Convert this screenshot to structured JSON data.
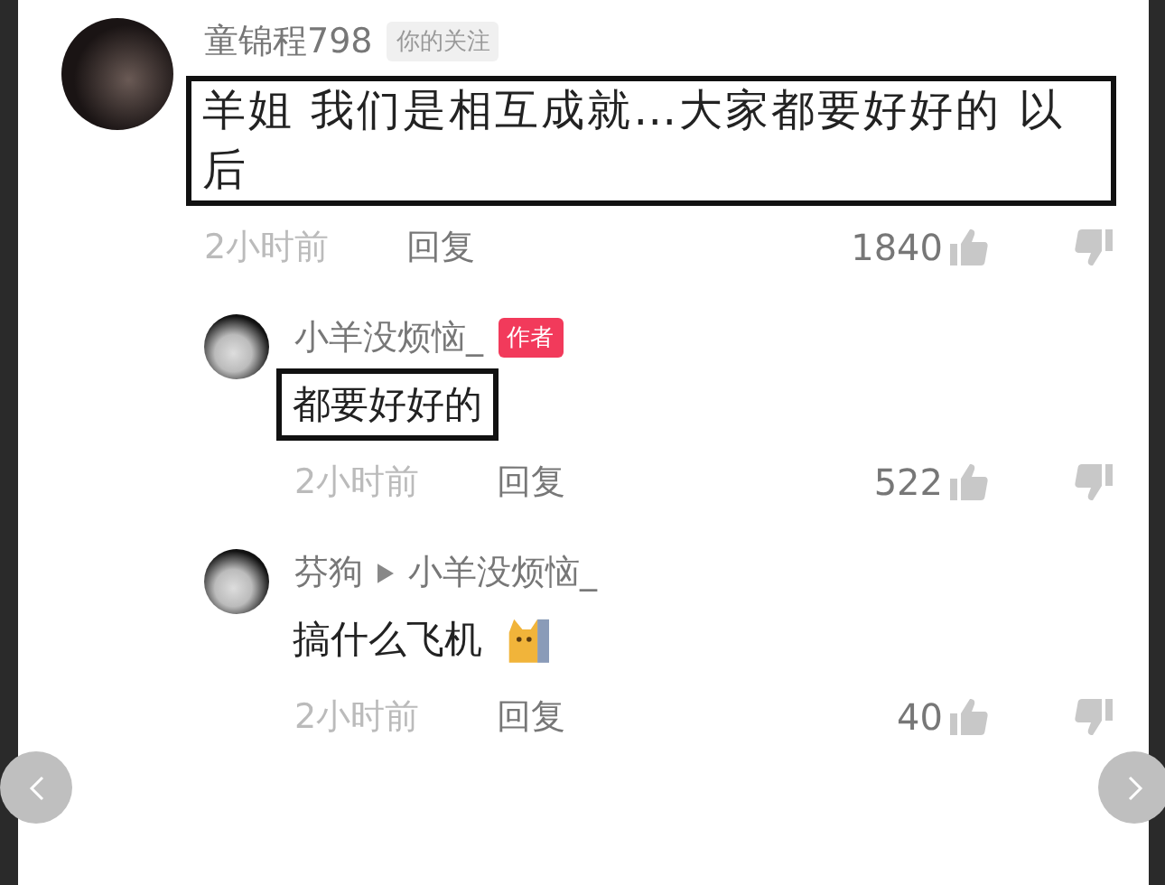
{
  "comments": [
    {
      "author": "童锦程798",
      "badge": "你的关注",
      "kind": "follow",
      "text": "羊姐 我们是相互成就…大家都要好好的 以后",
      "highlighted": true,
      "time": "2小时前",
      "reply": "回复",
      "likes": "1840",
      "replies": [
        {
          "author": "小羊没烦恼_",
          "badge": "作者",
          "kind": "author",
          "text": "都要好好的",
          "highlighted": true,
          "time": "2小时前",
          "reply": "回复",
          "likes": "522"
        },
        {
          "author": "芬狗",
          "reply_to": "小羊没烦恼_",
          "text": "搞什么飞机",
          "highlighted": false,
          "emoji": true,
          "time": "2小时前",
          "reply": "回复",
          "likes": "40"
        }
      ]
    }
  ]
}
